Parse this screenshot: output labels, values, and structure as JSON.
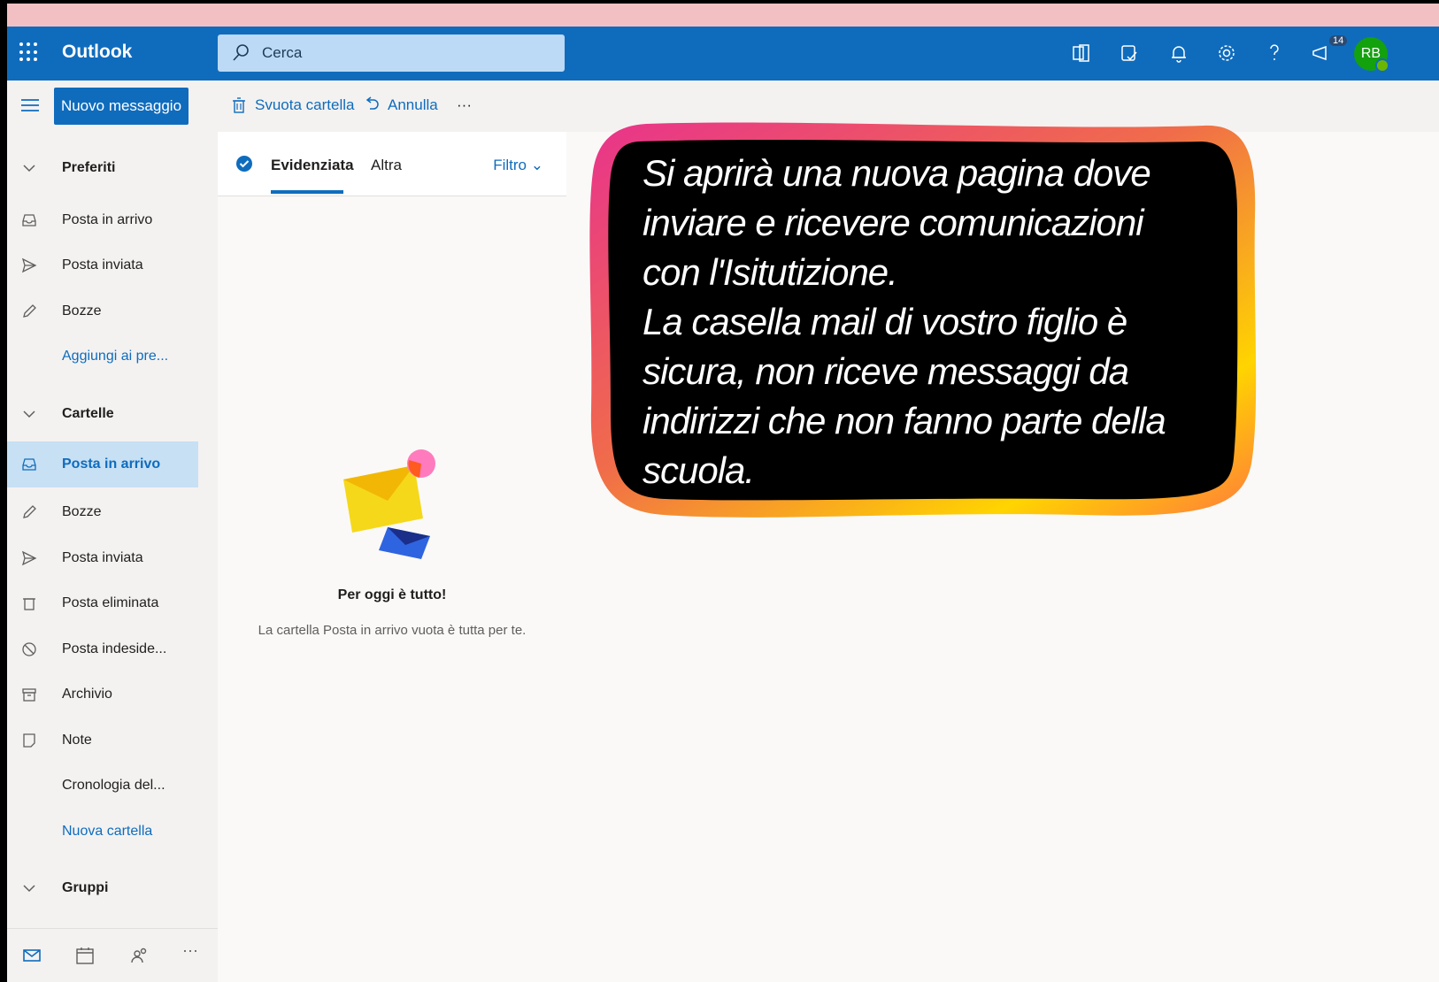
{
  "app": {
    "brand": "Outlook"
  },
  "search": {
    "placeholder": "Cerca"
  },
  "header": {
    "notification_badge": "14",
    "avatar_initials": "RB"
  },
  "toolbar": {
    "new_message": "Nuovo messaggio",
    "empty_folder": "Svuota cartella",
    "undo": "Annulla",
    "more": "···"
  },
  "sidebar": {
    "favorites_header": "Preferiti",
    "favorites": [
      {
        "label": "Posta in arrivo",
        "icon": "inbox-icon"
      },
      {
        "label": "Posta inviata",
        "icon": "send-icon"
      },
      {
        "label": "Bozze",
        "icon": "pencil-icon"
      },
      {
        "label": "Aggiungi ai pre...",
        "icon": ""
      }
    ],
    "folders_header": "Cartelle",
    "folders": [
      {
        "label": "Posta in arrivo",
        "icon": "inbox-icon",
        "selected": true
      },
      {
        "label": "Bozze",
        "icon": "pencil-icon"
      },
      {
        "label": "Posta inviata",
        "icon": "send-icon"
      },
      {
        "label": "Posta eliminata",
        "icon": "trash-icon"
      },
      {
        "label": "Posta indeside...",
        "icon": "block-icon"
      },
      {
        "label": "Archivio",
        "icon": "archive-icon"
      },
      {
        "label": "Note",
        "icon": "note-icon"
      },
      {
        "label": "Cronologia del...",
        "icon": ""
      },
      {
        "label": "Nuova cartella",
        "icon": ""
      }
    ],
    "groups_header": "Gruppi",
    "bottom_more": "···"
  },
  "list": {
    "tab_focused": "Evidenziata",
    "tab_other": "Altra",
    "filter": "Filtro",
    "empty_title": "Per oggi è tutto!",
    "empty_subtitle": "La cartella Posta in arrivo vuota è tutta per te."
  },
  "callout": {
    "text": "Si aprirà una nuova pagina dove\ninviare e ricevere comunicazioni\ncon l'Isitutizione.\nLa casella mail di vostro figlio è\nsicura, non riceve messaggi da\nindirizzi che non fanno parte della\nscuola."
  },
  "colors": {
    "brand_blue": "#0f6cbd",
    "selected_bg": "#c7e0f4",
    "callout_bg": "#000000",
    "avatar": "#13a10e"
  }
}
